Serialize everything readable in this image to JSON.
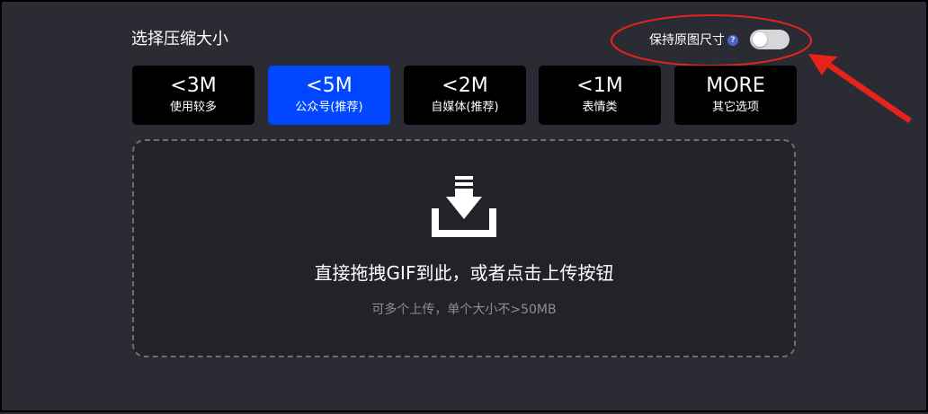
{
  "compress": {
    "title": "选择压缩大小",
    "keep_original_label": "保持原图尺寸",
    "help_symbol": "?",
    "keep_original_enabled": false,
    "options": [
      {
        "value": "<3M",
        "desc": "使用较多"
      },
      {
        "value": "<5M",
        "desc": "公众号(推荐)"
      },
      {
        "value": "<2M",
        "desc": "自媒体(推荐)"
      },
      {
        "value": "<1M",
        "desc": "表情类"
      },
      {
        "value": "MORE",
        "desc": "其它选项"
      }
    ],
    "selected_index": 1
  },
  "upload": {
    "icon": "download-tray-icon",
    "title": "直接拖拽GIF到此，或者点击上传按钮",
    "subtitle": "可多个上传，单个大小不>50MB"
  },
  "colors": {
    "background": "#2b2c33",
    "selected": "#0047ff",
    "option_bg": "#000000",
    "annotation": "#e8231c"
  }
}
